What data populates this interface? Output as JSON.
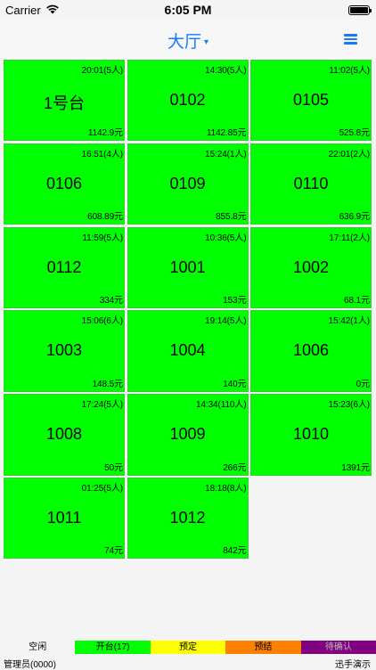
{
  "status_bar": {
    "carrier": "Carrier",
    "time": "6:05 PM"
  },
  "nav": {
    "title": "大厅",
    "caret": "▾",
    "menu_icon": "hamburger-menu-icon",
    "accent_color": "#1677ff"
  },
  "tables": [
    {
      "name": "1号台",
      "opened": "20:01(5人)",
      "amount": "1142.9元"
    },
    {
      "name": "0102",
      "opened": "14:30(5人)",
      "amount": "1142.85元"
    },
    {
      "name": "0105",
      "opened": "11:02(5人)",
      "amount": "525.8元"
    },
    {
      "name": "0106",
      "opened": "16:51(4人)",
      "amount": "608.89元"
    },
    {
      "name": "0109",
      "opened": "15:24(1人)",
      "amount": "855.8元"
    },
    {
      "name": "0110",
      "opened": "22:01(2人)",
      "amount": "636.9元"
    },
    {
      "name": "0112",
      "opened": "11:59(5人)",
      "amount": "334元"
    },
    {
      "name": "1001",
      "opened": "10:36(5人)",
      "amount": "153元"
    },
    {
      "name": "1002",
      "opened": "17:11(2人)",
      "amount": "68.1元"
    },
    {
      "name": "1003",
      "opened": "15:06(6人)",
      "amount": "148.5元"
    },
    {
      "name": "1004",
      "opened": "19:14(5人)",
      "amount": "140元"
    },
    {
      "name": "1006",
      "opened": "15:42(1人)",
      "amount": "0元"
    },
    {
      "name": "1008",
      "opened": "17:24(5人)",
      "amount": "50元"
    },
    {
      "name": "1009",
      "opened": "14:34(110人)",
      "amount": "266元"
    },
    {
      "name": "1010",
      "opened": "15:23(6人)",
      "amount": "1391元"
    },
    {
      "name": "1011",
      "opened": "01:25(5人)",
      "amount": "74元"
    },
    {
      "name": "1012",
      "opened": "18:18(8人)",
      "amount": "842元"
    }
  ],
  "legend": {
    "idle": "空闲",
    "open": "开台(17)",
    "reserved": "预定",
    "prebill": "预结",
    "pending": "待确认",
    "colors": {
      "idle": "#f4f4f4",
      "open": "#00ff00",
      "reserved": "#ffff00",
      "prebill": "#ff8000",
      "pending": "#800080"
    }
  },
  "footer": {
    "user": "管理员(0000)",
    "brand": "迅手演示"
  }
}
